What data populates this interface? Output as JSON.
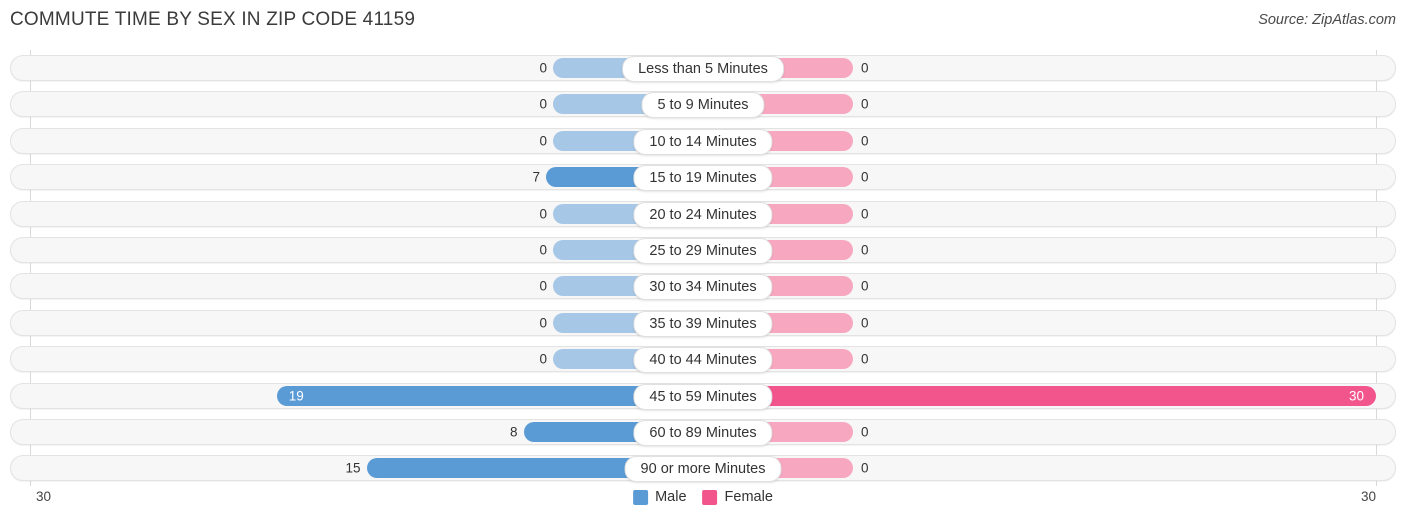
{
  "header": {
    "title": "COMMUTE TIME BY SEX IN ZIP CODE 41159",
    "source": "Source: ZipAtlas.com"
  },
  "legend": {
    "male_label": "Male",
    "female_label": "Female",
    "male_color": "#5b9bd5",
    "female_color": "#f2558c"
  },
  "axis": {
    "left_max": "30",
    "right_max": "30",
    "max_value": 30
  },
  "chart_data": {
    "type": "bar",
    "title": "COMMUTE TIME BY SEX IN ZIP CODE 41159",
    "subtitle": "Source: ZipAtlas.com",
    "orientation": "horizontal-diverging",
    "xlabel": "",
    "ylabel": "",
    "xlim": [
      30,
      0,
      30
    ],
    "grid": true,
    "legend_position": "bottom-center",
    "categories": [
      "Less than 5 Minutes",
      "5 to 9 Minutes",
      "10 to 14 Minutes",
      "15 to 19 Minutes",
      "20 to 24 Minutes",
      "25 to 29 Minutes",
      "30 to 34 Minutes",
      "35 to 39 Minutes",
      "40 to 44 Minutes",
      "45 to 59 Minutes",
      "60 to 89 Minutes",
      "90 or more Minutes"
    ],
    "series": [
      {
        "name": "Male",
        "values": [
          0,
          0,
          0,
          7,
          0,
          0,
          0,
          0,
          0,
          19,
          8,
          15
        ]
      },
      {
        "name": "Female",
        "values": [
          0,
          0,
          0,
          0,
          0,
          0,
          0,
          0,
          0,
          30,
          0,
          0
        ]
      }
    ]
  },
  "rows": [
    {
      "label": "Less than 5 Minutes",
      "male": "0",
      "female": "0"
    },
    {
      "label": "5 to 9 Minutes",
      "male": "0",
      "female": "0"
    },
    {
      "label": "10 to 14 Minutes",
      "male": "0",
      "female": "0"
    },
    {
      "label": "15 to 19 Minutes",
      "male": "7",
      "female": "0"
    },
    {
      "label": "20 to 24 Minutes",
      "male": "0",
      "female": "0"
    },
    {
      "label": "25 to 29 Minutes",
      "male": "0",
      "female": "0"
    },
    {
      "label": "30 to 34 Minutes",
      "male": "0",
      "female": "0"
    },
    {
      "label": "35 to 39 Minutes",
      "male": "0",
      "female": "0"
    },
    {
      "label": "40 to 44 Minutes",
      "male": "0",
      "female": "0"
    },
    {
      "label": "45 to 59 Minutes",
      "male": "19",
      "female": "30"
    },
    {
      "label": "60 to 89 Minutes",
      "male": "8",
      "female": "0"
    },
    {
      "label": "90 or more Minutes",
      "male": "15",
      "female": "0"
    }
  ]
}
